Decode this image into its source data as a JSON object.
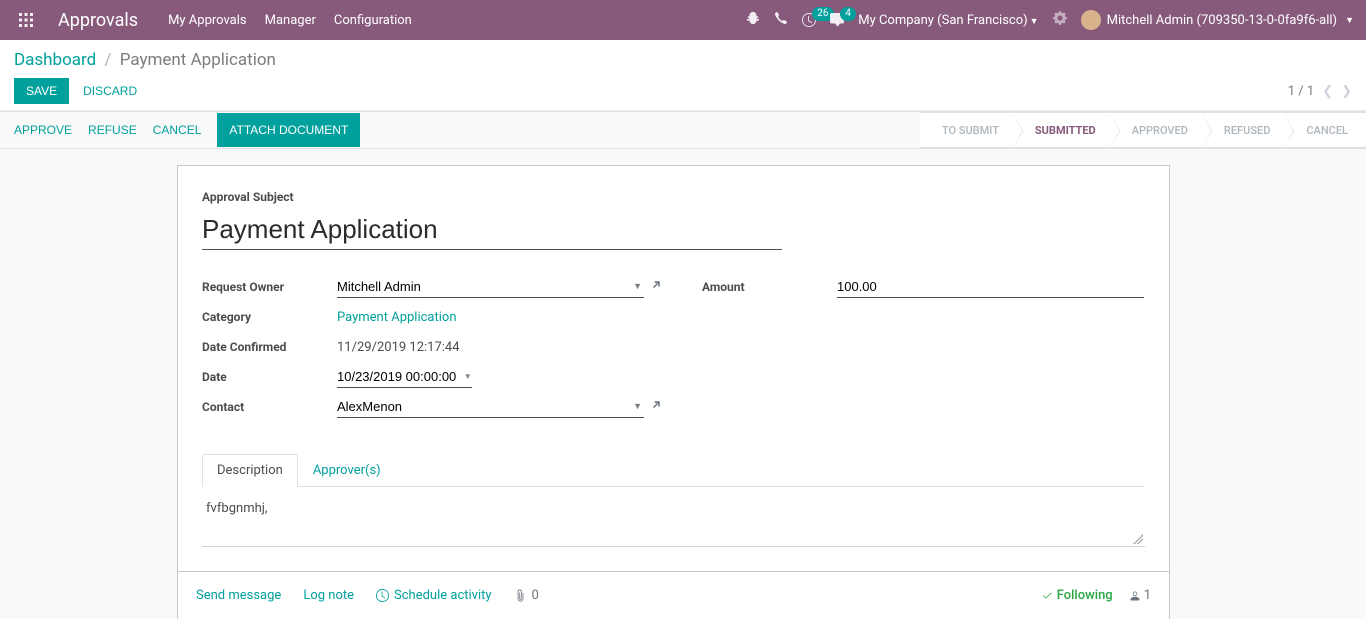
{
  "navbar": {
    "app_name": "Approvals",
    "menu": [
      "My Approvals",
      "Manager",
      "Configuration"
    ],
    "clock_badge": "26",
    "chat_badge": "4",
    "company": "My Company (San Francisco)",
    "user": "Mitchell Admin (709350-13-0-0fa9f6-all)"
  },
  "breadcrumb": {
    "root": "Dashboard",
    "current": "Payment Application"
  },
  "buttons": {
    "save": "Save",
    "discard": "Discard",
    "approve": "Approve",
    "refuse": "Refuse",
    "cancel": "Cancel",
    "attach": "Attach Document"
  },
  "pager": {
    "text": "1 / 1"
  },
  "status_steps": [
    "To Submit",
    "Submitted",
    "Approved",
    "Refused",
    "Cancel"
  ],
  "active_status": "Submitted",
  "form": {
    "subject_label": "Approval Subject",
    "subject_value": "Payment Application",
    "fields": {
      "request_owner": {
        "label": "Request Owner",
        "value": "Mitchell Admin"
      },
      "category": {
        "label": "Category",
        "value": "Payment Application"
      },
      "date_confirmed": {
        "label": "Date Confirmed",
        "value": "11/29/2019 12:17:44"
      },
      "date": {
        "label": "Date",
        "value": "10/23/2019 00:00:00"
      },
      "contact": {
        "label": "Contact",
        "value": "AlexMenon"
      },
      "amount": {
        "label": "Amount",
        "value": "100.00"
      }
    },
    "tabs": {
      "description": "Description",
      "approvers": "Approver(s)"
    },
    "description_text": "fvfbgnmhj,"
  },
  "chatter": {
    "send_message": "Send message",
    "log_note": "Log note",
    "schedule": "Schedule activity",
    "attach_count": "0",
    "following": "Following",
    "followers": "1"
  }
}
